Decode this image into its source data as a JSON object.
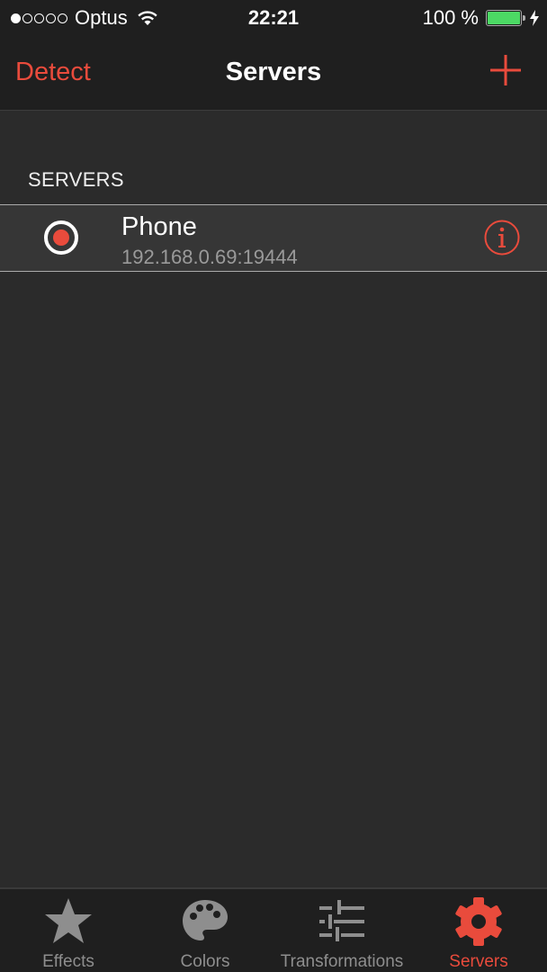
{
  "status_bar": {
    "signal_bars_filled": 1,
    "signal_bars_total": 5,
    "carrier": "Optus",
    "time": "22:21",
    "battery_text": "100 %",
    "battery_level": 1.0,
    "charging": true
  },
  "nav": {
    "left_button": "Detect",
    "title": "Servers",
    "right_icon": "plus-icon"
  },
  "section": {
    "header": "SERVERS"
  },
  "servers": [
    {
      "name": "Phone",
      "address": "192.168.0.69:19444",
      "selected": true,
      "accessory_icon": "info-icon"
    }
  ],
  "tabs": [
    {
      "label": "Effects",
      "icon": "star-icon",
      "active": false
    },
    {
      "label": "Colors",
      "icon": "palette-icon",
      "active": false
    },
    {
      "label": "Transformations",
      "icon": "sliders-icon",
      "active": false
    },
    {
      "label": "Servers",
      "icon": "gear-icon",
      "active": true
    }
  ],
  "colors": {
    "accent": "#e94b3c",
    "inactive_tab": "#8e8e8e",
    "battery": "#4cd964",
    "bar_background": "#1f1f1f",
    "background": "#2b2b2b"
  }
}
